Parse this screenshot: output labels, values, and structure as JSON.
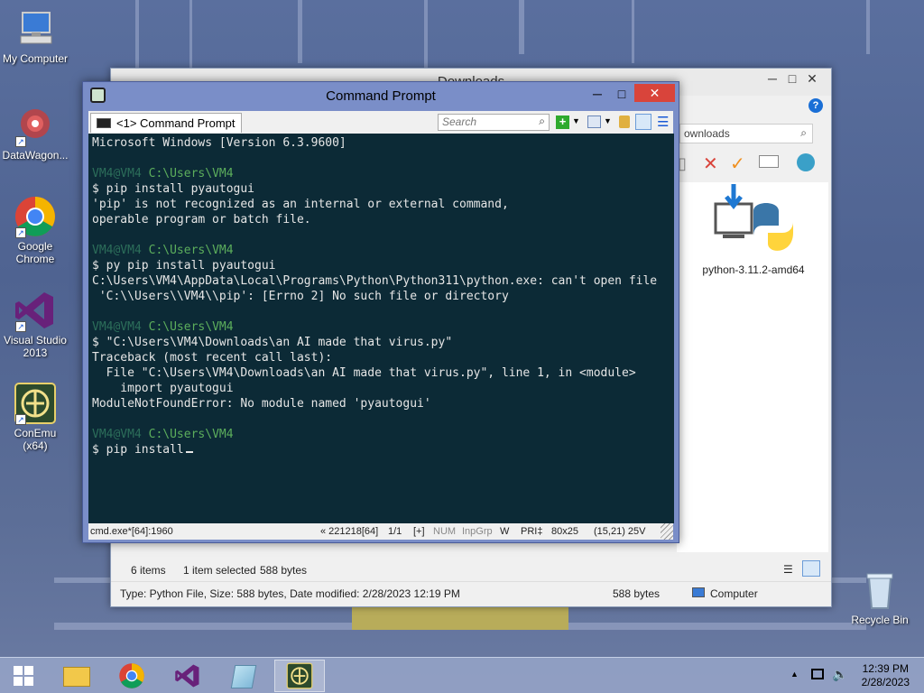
{
  "desktop": {
    "icons": [
      {
        "label": "My Computer"
      },
      {
        "label": "DataWagon..."
      },
      {
        "label": "Google Chrome"
      },
      {
        "label": "Visual Studio 2013"
      },
      {
        "label": "ConEmu (x64)"
      },
      {
        "label": "Recycle Bin"
      }
    ]
  },
  "explorer": {
    "title": "Downloads",
    "search_value": "ownloads",
    "file_name": "python-3.11.2-amd64",
    "status_items": "6 items",
    "status_selected": "1 item selected",
    "status_size": "588 bytes",
    "detail_text": "Type: Python File, Size: 588 bytes, Date modified: 2/28/2023 12:19 PM",
    "detail_size": "588 bytes",
    "detail_location": "Computer"
  },
  "cmd": {
    "title": "Command Prompt",
    "tab_label": "<1> Command Prompt",
    "search_placeholder": "Search",
    "lines": [
      {
        "type": "text",
        "text": "Microsoft Windows [Version 6.3.9600]"
      },
      {
        "type": "blank",
        "text": ""
      },
      {
        "type": "prompt",
        "user": "VM4@VM4",
        "path": "C:\\Users\\VM4"
      },
      {
        "type": "text",
        "text": "$ pip install pyautogui"
      },
      {
        "type": "text",
        "text": "'pip' is not recognized as an internal or external command,"
      },
      {
        "type": "text",
        "text": "operable program or batch file."
      },
      {
        "type": "blank",
        "text": ""
      },
      {
        "type": "prompt",
        "user": "VM4@VM4",
        "path": "C:\\Users\\VM4"
      },
      {
        "type": "text",
        "text": "$ py pip install pyautogui"
      },
      {
        "type": "text",
        "text": "C:\\Users\\VM4\\AppData\\Local\\Programs\\Python\\Python311\\python.exe: can't open file"
      },
      {
        "type": "text",
        "text": " 'C:\\\\Users\\\\VM4\\\\pip': [Errno 2] No such file or directory"
      },
      {
        "type": "blank",
        "text": ""
      },
      {
        "type": "prompt",
        "user": "VM4@VM4",
        "path": "C:\\Users\\VM4"
      },
      {
        "type": "text",
        "text": "$ \"C:\\Users\\VM4\\Downloads\\an AI made that virus.py\""
      },
      {
        "type": "text",
        "text": "Traceback (most recent call last):"
      },
      {
        "type": "text",
        "text": "  File \"C:\\Users\\VM4\\Downloads\\an AI made that virus.py\", line 1, in <module>"
      },
      {
        "type": "text",
        "text": "    import pyautogui"
      },
      {
        "type": "text",
        "text": "ModuleNotFoundError: No module named 'pyautogui'"
      },
      {
        "type": "blank",
        "text": ""
      },
      {
        "type": "prompt",
        "user": "VM4@VM4",
        "path": "C:\\Users\\VM4"
      },
      {
        "type": "text",
        "text": "$ pip install"
      }
    ],
    "status": {
      "process": "cmd.exe*[64]:1960",
      "pid": "« 221218[64]",
      "console": "1/1",
      "plus": "[+]",
      "num": "NUM",
      "inpgrp": "InpGrp",
      "w": "W",
      "pri": "PRI‡",
      "size": "80x25",
      "cursor": "(15,21) 25V"
    }
  },
  "taskbar": {
    "time": "12:39 PM",
    "date": "2/28/2023"
  },
  "colors": {
    "console_bg": "#0c2a36",
    "prompt_user": "#2c6e5a",
    "prompt_path": "#5cae5c",
    "cmd_frame": "#7a8ec8",
    "close_red": "#d9443b"
  }
}
